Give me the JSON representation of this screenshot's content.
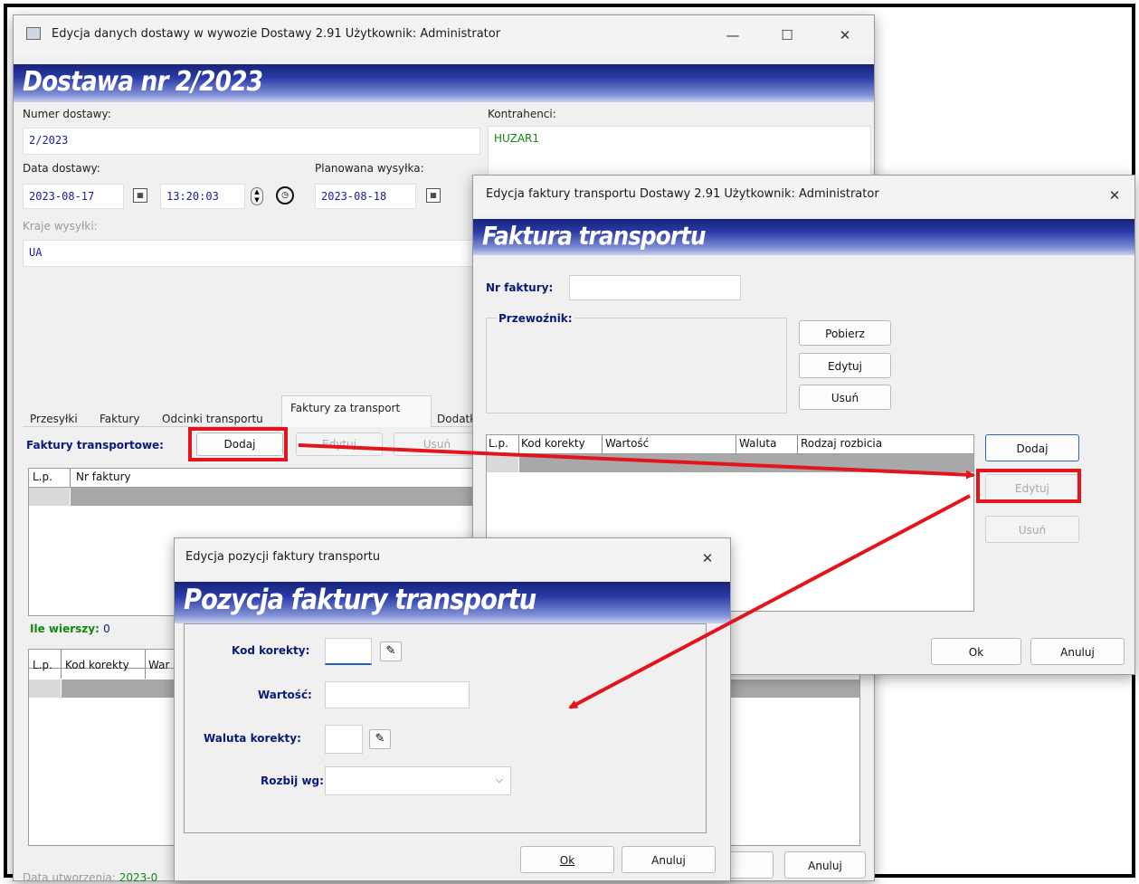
{
  "main_window": {
    "title": "Edycja danych dostawy w wywozie Dostawy 2.91 Użytkownik: Administrator",
    "banner": "Dostawa nr 2/2023",
    "numer_label": "Numer dostawy:",
    "numer_value": "2/2023",
    "kontrahenci_label": "Kontrahenci:",
    "kontrahenci_value": "HUZAR1",
    "data_label": "Data dostawy:",
    "data_value": "2023-08-17",
    "time_value": "13:20:03",
    "planowana_label": "Planowana wysyłka:",
    "planowana_value": "2023-08-18",
    "kraje_label": "Kraje wysyłki:",
    "kraje_value": "UA",
    "tabs": [
      "Przesyłki",
      "Faktury",
      "Odcinki transportu",
      "Faktury za transport",
      "Dodatk"
    ],
    "faktury_label": "Faktury transportowe:",
    "dodaj": "Dodaj",
    "edytuj": "Edytuj",
    "usun": "Usuń",
    "grid1_headers": [
      "L.p.",
      "Nr faktury"
    ],
    "ile_label": "Ile wierszy:",
    "ile_value": "0",
    "grid2_headers": [
      "L.p.",
      "Kod korekty",
      "War"
    ],
    "data_utworzenia_label": "Data utworzenia:",
    "data_utworzenia_value": "2023-0",
    "anuluj": "Anuluj"
  },
  "invoice_window": {
    "title": "Edycja faktury transportu Dostawy 2.91 Użytkownik: Administrator",
    "banner": "Faktura transportu",
    "nr_label": "Nr faktury:",
    "nr_value": "",
    "przewoznik_label": "Przewoźnik:",
    "pobierz": "Pobierz",
    "edytuj": "Edytuj",
    "usun": "Usuń",
    "grid_headers": [
      "L.p.",
      "Kod korekty",
      "Wartość",
      "Waluta",
      "Rodzaj rozbicia"
    ],
    "dodaj": "Dodaj",
    "edytuj2": "Edytuj",
    "usun2": "Usuń",
    "ok": "Ok",
    "anuluj": "Anuluj"
  },
  "position_window": {
    "title": "Edycja pozycji faktury transportu",
    "banner": "Pozycja faktury transportu",
    "kod_label": "Kod korekty:",
    "kod_value": "",
    "wartosc_label": "Wartość:",
    "wartosc_value": "",
    "waluta_label": "Waluta korekty:",
    "waluta_value": "",
    "rozbij_label": "Rozbij wg:",
    "rozbij_value": "",
    "ok": "Ok",
    "anuluj": "Anuluj"
  },
  "colors": {
    "annotation": "#e3141b",
    "banner_dark": "#17237a",
    "label_blue": "#0a1a7a",
    "value_green": "#0e8a0e"
  },
  "icons": [
    "app-icon",
    "minimize-icon",
    "maximize-icon",
    "close-icon",
    "calendar-icon",
    "spinner-icon",
    "stopwatch-icon",
    "book-icon",
    "chevron-down-icon"
  ]
}
